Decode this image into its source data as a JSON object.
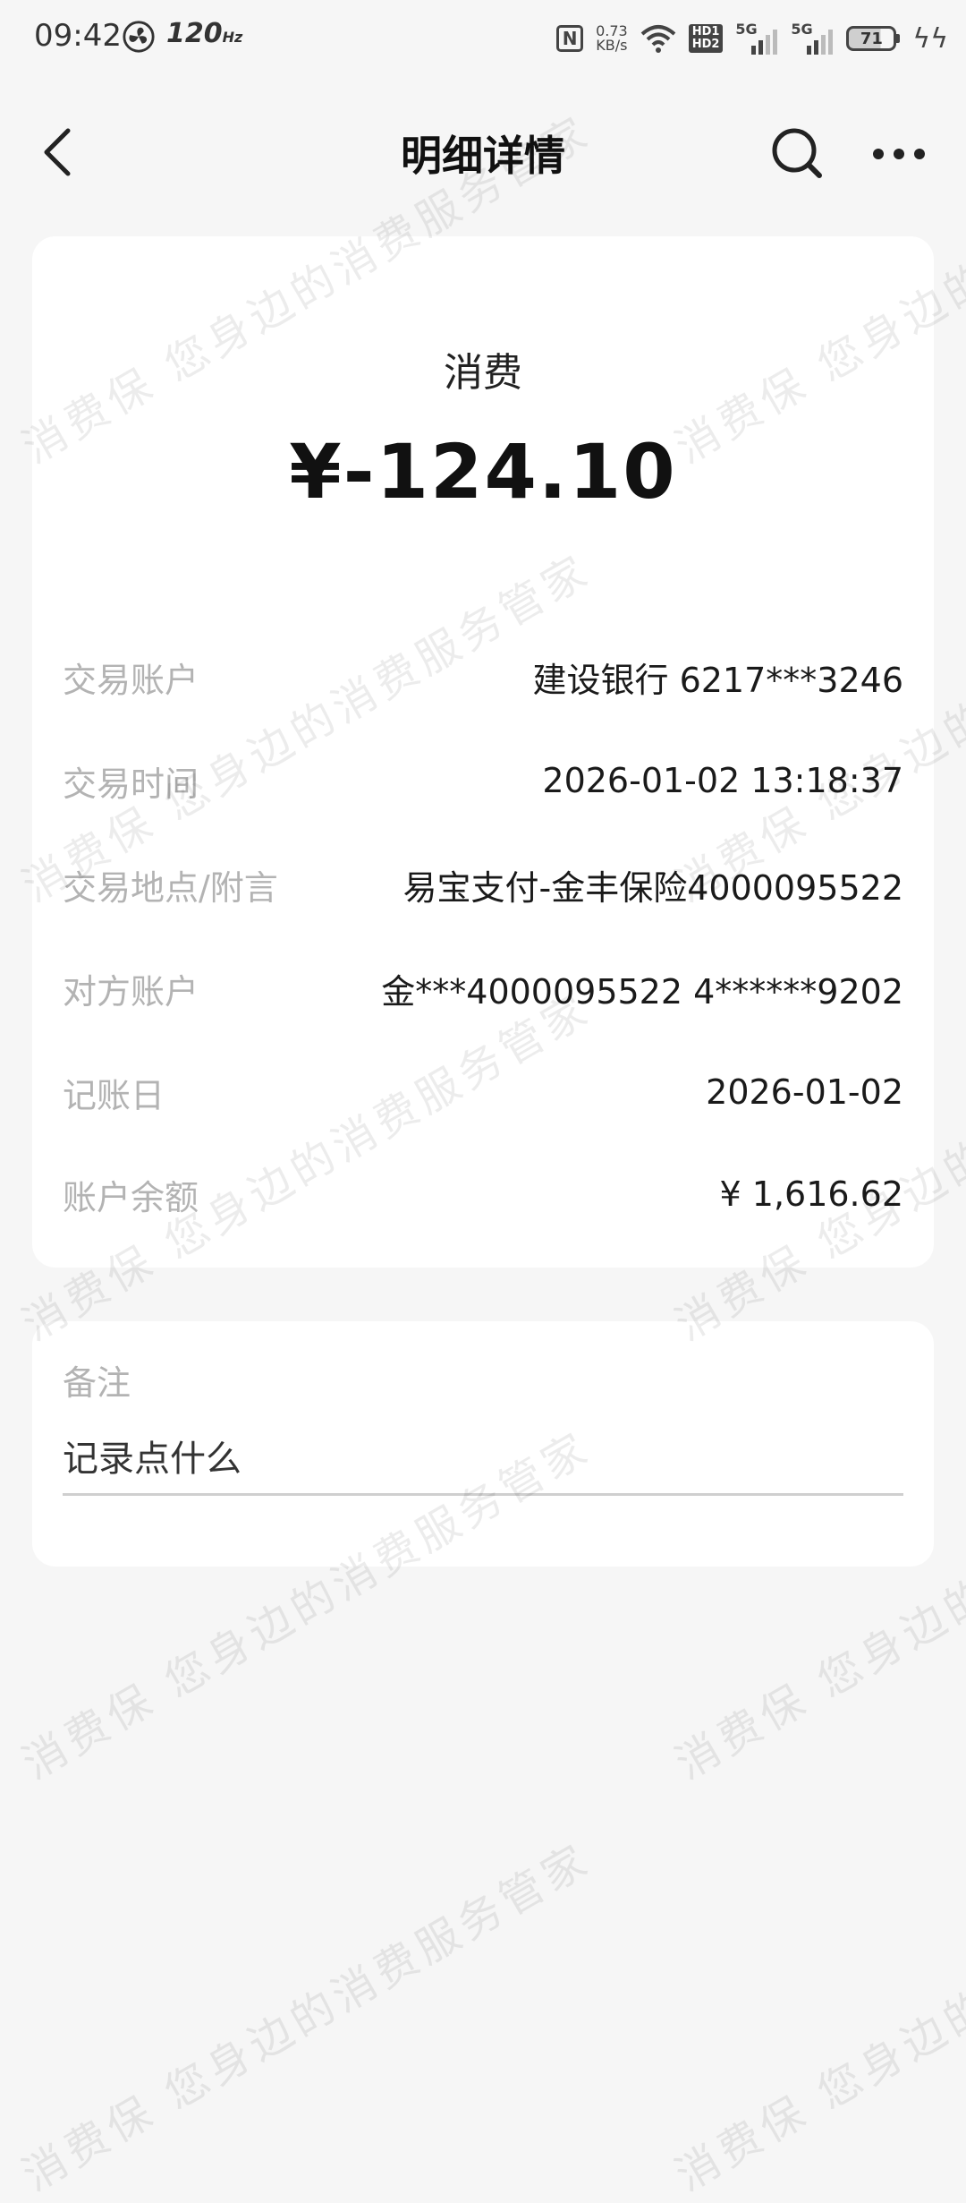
{
  "status_bar": {
    "time": "09:42",
    "refresh_rate": "120",
    "refresh_unit": "Hz",
    "nfc": "N",
    "net_speed_value": "0.73",
    "net_speed_unit": "KB/s",
    "hd_top": "HD1",
    "hd_bottom": "HD2",
    "sim1_label": "5G",
    "sim2_label": "5G",
    "battery": "71",
    "battery_level_percent": 71
  },
  "header": {
    "title": "明细详情"
  },
  "transaction": {
    "type": "消费",
    "amount": "¥-124.10",
    "rows": [
      {
        "label": "交易账户",
        "value": "建设银行 6217***3246"
      },
      {
        "label": "交易时间",
        "value": "2026-01-02 13:18:37"
      },
      {
        "label": "交易地点/附言",
        "value": "易宝支付-金丰保险4000095522"
      },
      {
        "label": "对方账户",
        "value": "金***4000095522 4******9202"
      },
      {
        "label": "记账日",
        "value": "2026-01-02"
      },
      {
        "label": "账户余额",
        "value": "¥ 1,616.62"
      }
    ]
  },
  "note": {
    "title": "备注",
    "placeholder": "记录点什么"
  },
  "watermark": {
    "text": "消费保 您身边的消费服务管家"
  },
  "icons": {
    "back": "chevron-left-icon",
    "search": "search-icon",
    "more": "more-dots-icon"
  }
}
